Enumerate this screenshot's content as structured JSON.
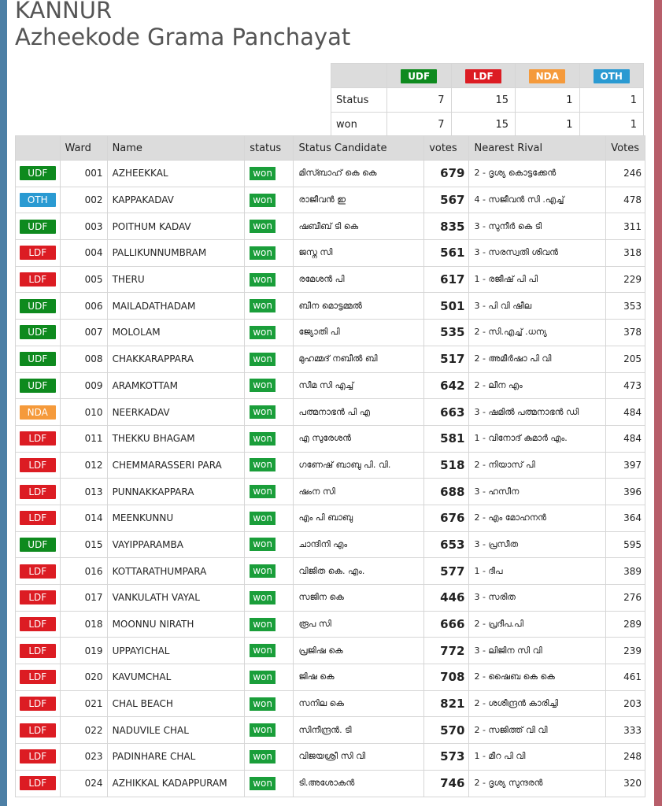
{
  "header": {
    "district": "KANNUR",
    "panchayat": "Azheekode Grama Panchayat"
  },
  "summary": {
    "parties": [
      "UDF",
      "LDF",
      "NDA",
      "OTH"
    ],
    "rows": [
      {
        "label": "Status",
        "values": [
          "7",
          "15",
          "1",
          "1"
        ]
      },
      {
        "label": "won",
        "values": [
          "7",
          "15",
          "1",
          "1"
        ]
      }
    ]
  },
  "table": {
    "headers": [
      "",
      "Ward",
      "Name",
      "status",
      "Status Candidate",
      "votes",
      "Nearest Rival",
      "Votes"
    ],
    "rows": [
      {
        "party": "UDF",
        "ward": "001",
        "name": "AZHEEKKAL",
        "status": "won",
        "candidate": "മിസ്ബാഹ് കെ കെ",
        "votes": "679",
        "rival": "2 - ദൃശ്യ കൊട്ടക്കേൻ",
        "rival_votes": "246"
      },
      {
        "party": "OTH",
        "ward": "002",
        "name": "KAPPAKADAV",
        "status": "won",
        "candidate": "രാജീവൻ ഇ",
        "votes": "567",
        "rival": "4 - സജീവൻ സി .എച്ച്",
        "rival_votes": "478"
      },
      {
        "party": "UDF",
        "ward": "003",
        "name": "POITHUM KADAV",
        "status": "won",
        "candidate": "ഷബീബ് ടി കെ",
        "votes": "835",
        "rival": "3 - സുനീർ കെ ടി",
        "rival_votes": "311"
      },
      {
        "party": "LDF",
        "ward": "004",
        "name": "PALLIKUNNUMBRAM",
        "status": "won",
        "candidate": "ജസ്ന സി",
        "votes": "561",
        "rival": "3 - സരസ്വതി ശിവൻ",
        "rival_votes": "318"
      },
      {
        "party": "LDF",
        "ward": "005",
        "name": "THERU",
        "status": "won",
        "candidate": "രമേശൻ പി",
        "votes": "617",
        "rival": "1 - രജീഷ് പി പി",
        "rival_votes": "229"
      },
      {
        "party": "UDF",
        "ward": "006",
        "name": "MAILADATHADAM",
        "status": "won",
        "candidate": "ബീന മൊട്ടമ്മൽ",
        "votes": "501",
        "rival": "3 - പി വി ഷീല",
        "rival_votes": "353"
      },
      {
        "party": "UDF",
        "ward": "007",
        "name": "MOLOLAM",
        "status": "won",
        "candidate": "ജ്യോതി പി",
        "votes": "535",
        "rival": "2 - സി.എച്ച് .ധന്യ",
        "rival_votes": "378"
      },
      {
        "party": "UDF",
        "ward": "008",
        "name": "CHAKKARAPPARA",
        "status": "won",
        "candidate": "മുഹമ്മദ് നബീൽ ബി",
        "votes": "517",
        "rival": "2 - അമീർഷാ പി വി",
        "rival_votes": "205"
      },
      {
        "party": "UDF",
        "ward": "009",
        "name": "ARAMKOTTAM",
        "status": "won",
        "candidate": "സീമ സി എച്ച്",
        "votes": "642",
        "rival": "2 - ലീന എം",
        "rival_votes": "473"
      },
      {
        "party": "NDA",
        "ward": "010",
        "name": "NEERKADAV",
        "status": "won",
        "candidate": "പത്മനാഭൻ പി എ",
        "votes": "663",
        "rival": "3 - ഷമിൽ പത്മനാഭൻ ഡി",
        "rival_votes": "484"
      },
      {
        "party": "LDF",
        "ward": "011",
        "name": "THEKKU BHAGAM",
        "status": "won",
        "candidate": "എ സുരേശൻ",
        "votes": "581",
        "rival": "1 - വിനോദ് കുമാർ എം.",
        "rival_votes": "484"
      },
      {
        "party": "LDF",
        "ward": "012",
        "name": "CHEMMARASSERI PARA",
        "status": "won",
        "candidate": "ഗണേഷ് ബാബു പി. വി.",
        "votes": "518",
        "rival": "2 - നിയാസ് പി",
        "rival_votes": "397"
      },
      {
        "party": "LDF",
        "ward": "013",
        "name": "PUNNAKKAPPARA",
        "status": "won",
        "candidate": "ഷംന സി",
        "votes": "688",
        "rival": "3 - ഹസീന",
        "rival_votes": "396"
      },
      {
        "party": "LDF",
        "ward": "014",
        "name": "MEENKUNNU",
        "status": "won",
        "candidate": "എം പി ബാബു",
        "votes": "676",
        "rival": "2 - എം മോഹനൻ",
        "rival_votes": "364"
      },
      {
        "party": "UDF",
        "ward": "015",
        "name": "VAYIPPARAMBA",
        "status": "won",
        "candidate": "ചാന്ദിനി എം",
        "votes": "653",
        "rival": "3 - പ്രസീത",
        "rival_votes": "595"
      },
      {
        "party": "LDF",
        "ward": "016",
        "name": "KOTTARATHUMPARA",
        "status": "won",
        "candidate": "വിജിത കെ. എം.",
        "votes": "577",
        "rival": "1 - ദീപ",
        "rival_votes": "389"
      },
      {
        "party": "LDF",
        "ward": "017",
        "name": "VANKULATH VAYAL",
        "status": "won",
        "candidate": "സജിന കെ",
        "votes": "446",
        "rival": "3 - സരിത",
        "rival_votes": "276"
      },
      {
        "party": "LDF",
        "ward": "018",
        "name": "MOONNU NIRATH",
        "status": "won",
        "candidate": "രൂപ സി",
        "votes": "666",
        "rival": "2 - പ്രദീപ.പി",
        "rival_votes": "289"
      },
      {
        "party": "LDF",
        "ward": "019",
        "name": "UPPAYICHAL",
        "status": "won",
        "candidate": "പ്രജിഷ കെ",
        "votes": "772",
        "rival": "3 - ലിജിന സി വി",
        "rival_votes": "239"
      },
      {
        "party": "LDF",
        "ward": "020",
        "name": "KAVUMCHAL",
        "status": "won",
        "candidate": "ജിഷ കെ",
        "votes": "708",
        "rival": "2 - ഷൈബ കെ കെ",
        "rival_votes": "461"
      },
      {
        "party": "LDF",
        "ward": "021",
        "name": "CHAL BEACH",
        "status": "won",
        "candidate": "സനില കെ",
        "votes": "821",
        "rival": "2 - ശശീന്ദ്രൻ കാരിച്ചി",
        "rival_votes": "203"
      },
      {
        "party": "LDF",
        "ward": "022",
        "name": "NADUVILE CHAL",
        "status": "won",
        "candidate": "സിനീന്ദ്രൻ. ടി",
        "votes": "570",
        "rival": "2 - സജിത്ത് വി വി",
        "rival_votes": "333"
      },
      {
        "party": "LDF",
        "ward": "023",
        "name": "PADINHARE CHAL",
        "status": "won",
        "candidate": "വിജയശ്രീ സി വി",
        "votes": "573",
        "rival": "1 - മീറ പി വി",
        "rival_votes": "248"
      },
      {
        "party": "LDF",
        "ward": "024",
        "name": "AZHIKKAL KADAPPURAM",
        "status": "won",
        "candidate": "ടി.അശോകൻ",
        "votes": "746",
        "rival": "2 - ദൃശ്യ സുന്ദരൻ",
        "rival_votes": "320"
      }
    ]
  },
  "colors": {
    "UDF": "#0e8a1e",
    "LDF": "#dc1c23",
    "NDA": "#f59a3b",
    "OTH": "#2a9ad2",
    "won": "#1a9e3a"
  }
}
